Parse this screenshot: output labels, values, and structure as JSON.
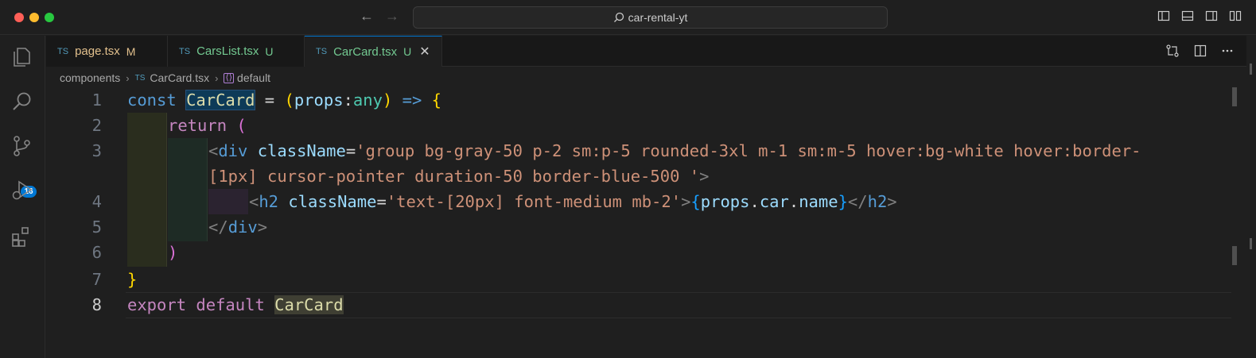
{
  "window": {
    "search_text": "car-rental-yt"
  },
  "activity": {
    "items": [
      "explorer-icon",
      "search-icon",
      "source-control-icon",
      "run-debug-icon",
      "extensions-icon"
    ],
    "scm_badge": "16"
  },
  "tabs": [
    {
      "type": "TS",
      "name": "page.tsx",
      "status": "M"
    },
    {
      "type": "TS",
      "name": "CarsList.tsx",
      "status": "U"
    },
    {
      "type": "TS",
      "name": "CarCard.tsx",
      "status": "U",
      "close": "✕"
    }
  ],
  "breadcrumb": {
    "folder": "components",
    "file_type": "TS",
    "file": "CarCard.tsx",
    "symbol": "default"
  },
  "line_numbers": [
    "1",
    "2",
    "3",
    "4",
    "5",
    "6",
    "7",
    "8"
  ],
  "code": {
    "l1": {
      "kw": "const",
      "name": "CarCard",
      "eq": " = ",
      "paren": "(",
      "param": "props",
      "colon": ":",
      "type": "any",
      "close": ")",
      "arrow": " => ",
      "brace": "{"
    },
    "l2": {
      "kw": "return",
      "paren": " ("
    },
    "l3a": {
      "open": "<",
      "tag": "div",
      "attr": "className",
      "eq": "=",
      "str": "'group bg-gray-50 p-2 sm:p-5 rounded-3xl m-1 sm:m-5 hover:bg-white hover:border-"
    },
    "l3b": {
      "str": "[1px] cursor-pointer duration-50 border-blue-500 '",
      "close": ">"
    },
    "l4": {
      "open": "<",
      "tag": "h2",
      "attr": "className",
      "eq": "=",
      "str": "'text-[20px] font-medium mb-2'",
      "gt": ">",
      "lb": "{",
      "obj": "props",
      "d1": ".",
      "p1": "car",
      "d2": ".",
      "p2": "name",
      "rb": "}",
      "endopen": "</",
      "endtag": "h2",
      "endgt": ">"
    },
    "l5": {
      "open": "</",
      "tag": "div",
      "gt": ">"
    },
    "l6": {
      "paren": ")"
    },
    "l7": {
      "brace": "}"
    },
    "l8": {
      "kw1": "export",
      "kw2": " default ",
      "name": "CarCard"
    }
  }
}
